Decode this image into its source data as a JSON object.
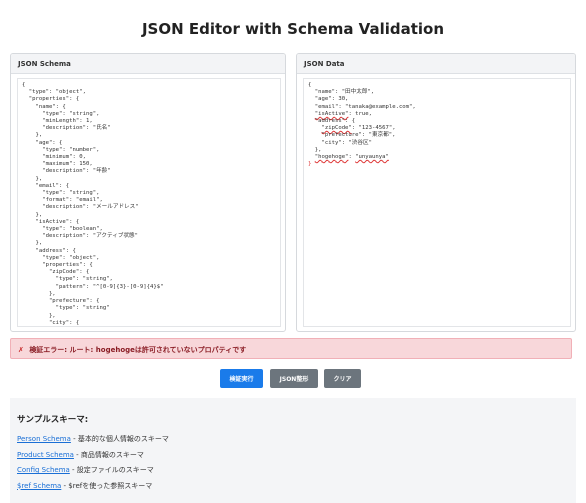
{
  "page": {
    "title": "JSON Editor with Schema Validation"
  },
  "schema_panel": {
    "label": "JSON Schema",
    "lines": [
      "{",
      "  \"type\": \"object\",",
      "  \"properties\": {",
      "    \"name\": {",
      "      \"type\": \"string\",",
      "      \"minLength\": 1,",
      "      \"description\": \"氏名\"",
      "    },",
      "    \"age\": {",
      "      \"type\": \"number\",",
      "      \"minimum\": 0,",
      "      \"maximum\": 150,",
      "      \"description\": \"年齢\"",
      "    },",
      "    \"email\": {",
      "      \"type\": \"string\",",
      "      \"format\": \"email\",",
      "      \"description\": \"メールアドレス\"",
      "    },",
      "    \"isActive\": {",
      "      \"type\": \"boolean\",",
      "      \"description\": \"アクティブ状態\"",
      "    },",
      "    \"address\": {",
      "      \"type\": \"object\",",
      "      \"properties\": {",
      "        \"zipCode\": {",
      "          \"type\": \"string\",",
      "          \"pattern\": \"^[0-9]{3}-[0-9]{4}$\"",
      "        },",
      "        \"prefecture\": {",
      "          \"type\": \"string\"",
      "        },",
      "        \"city\": {"
    ]
  },
  "data_panel": {
    "label": "JSON Data",
    "lines": [
      {
        "pre": "{",
        "key": "",
        "post": ""
      },
      {
        "pre": "  ",
        "key": "",
        "post": "\"name\": \"田中太郎\","
      },
      {
        "pre": "  ",
        "key": "",
        "post": "\"age\": 30,"
      },
      {
        "pre": "  ",
        "key": "",
        "post": "\"email\": \"tanaka@example.com\","
      },
      {
        "pre": "  ",
        "key": "\"isActive\"",
        "post": ": true,"
      },
      {
        "pre": "  ",
        "key": "",
        "post": "\"address\": {"
      },
      {
        "pre": "    ",
        "key": "\"zipCode\"",
        "post": ": \"123-4567\","
      },
      {
        "pre": "    ",
        "key": "",
        "post": "\"prefecture\": \"東京都\","
      },
      {
        "pre": "    ",
        "key": "",
        "post": "\"city\": \"渋谷区\""
      },
      {
        "pre": "  ",
        "key": "",
        "post": "},"
      },
      {
        "pre": "  ",
        "key": "\"hogehoge\"",
        "post": ": ",
        "val": "\"unyaunya\""
      },
      {
        "pre": "}",
        "key": "",
        "post": ""
      }
    ]
  },
  "error": {
    "icon": "✗",
    "message": "検証エラー: ルート: hogehogeは許可されていないプロパティです"
  },
  "buttons": {
    "validate": "検証実行",
    "format": "JSON整形",
    "clear": "クリア"
  },
  "samples": {
    "title": "サンプルスキーマ:",
    "items": [
      {
        "link": "Person Schema",
        "desc": " - 基本的な個人情報のスキーマ"
      },
      {
        "link": "Product Schema",
        "desc": " - 商品情報のスキーマ"
      },
      {
        "link": "Config Schema",
        "desc": " - 設定ファイルのスキーマ"
      },
      {
        "link": "$ref Schema",
        "desc": " - $refを使った参照スキーマ"
      }
    ]
  },
  "colors": {
    "accent": "#1a7bea",
    "secondary": "#6c757d",
    "error_bg": "#f8d7da",
    "error_text": "#8a1c24"
  }
}
